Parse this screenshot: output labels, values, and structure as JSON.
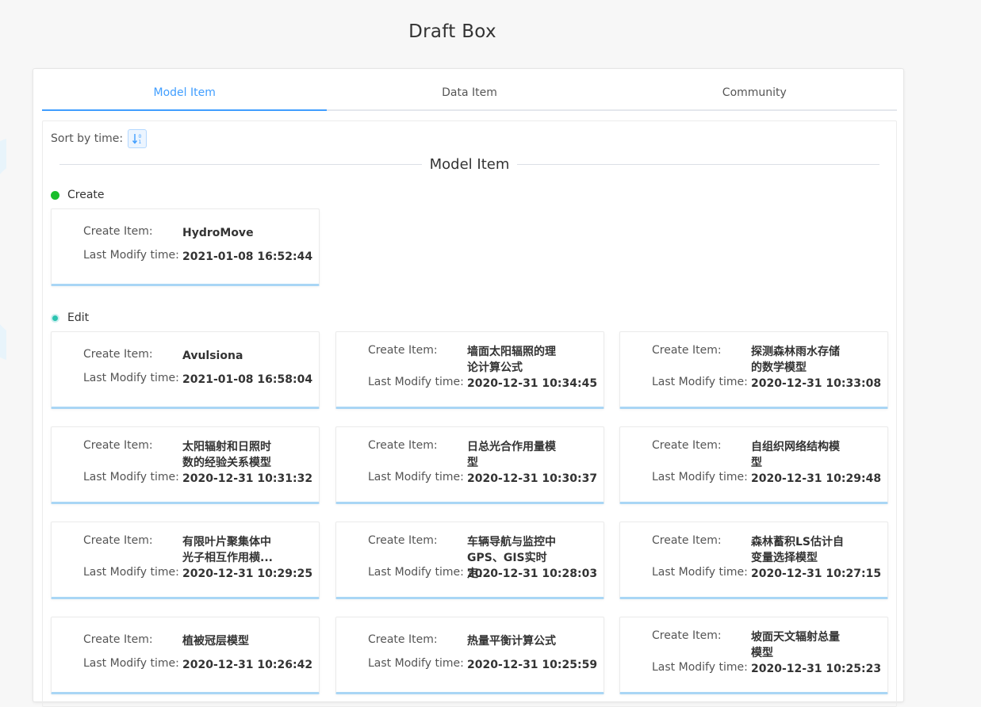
{
  "page": {
    "title": "Draft Box"
  },
  "tabs": [
    {
      "label": "Model Item",
      "active": true
    },
    {
      "label": "Data Item",
      "active": false
    },
    {
      "label": "Community",
      "active": false
    }
  ],
  "sort": {
    "label": "Sort by time:",
    "icon": "sort-ascending-icon"
  },
  "section_title": "Model Item",
  "create": {
    "label": "Create",
    "dot_color": "#19be2b",
    "items": [
      {
        "name": "HydroMove",
        "time": "2021-01-08 16:52:44"
      }
    ]
  },
  "edit": {
    "label": "Edit",
    "dot_color": "#2bc4b0",
    "items": [
      {
        "name": "Avulsiona",
        "time": "2021-01-08 16:58:04"
      },
      {
        "name": "墙面太阳辐照的理论计算公式",
        "time": "2020-12-31 10:34:45"
      },
      {
        "name": "探测森林雨水存储的数学模型",
        "time": "2020-12-31 10:33:08"
      },
      {
        "name": "太阳辐射和日照时数的经验关系模型",
        "time": "2020-12-31 10:31:32"
      },
      {
        "name": "日总光合作用量模型",
        "time": "2020-12-31 10:30:37"
      },
      {
        "name": "自组织网络结构模型",
        "time": "2020-12-31 10:29:48"
      },
      {
        "name": "有限叶片聚集体中光子相互作用横...",
        "time": "2020-12-31 10:29:25"
      },
      {
        "name": "车辆导航与监控中GPS、GIS实时定...",
        "time": "2020-12-31 10:28:03"
      },
      {
        "name": "森林蓄积LS估计自变量选择模型",
        "time": "2020-12-31 10:27:15"
      },
      {
        "name": "植被冠层模型",
        "time": "2020-12-31 10:26:42"
      },
      {
        "name": "热量平衡计算公式",
        "time": "2020-12-31 10:25:59"
      },
      {
        "name": "坡面天文辐射总量模型",
        "time": "2020-12-31 10:25:23"
      }
    ]
  },
  "card_labels": {
    "create_item": "Create Item:",
    "last_modify": "Last Modify time:"
  },
  "colors": {
    "accent": "#409eff",
    "card_border": "#a9d6f5"
  }
}
